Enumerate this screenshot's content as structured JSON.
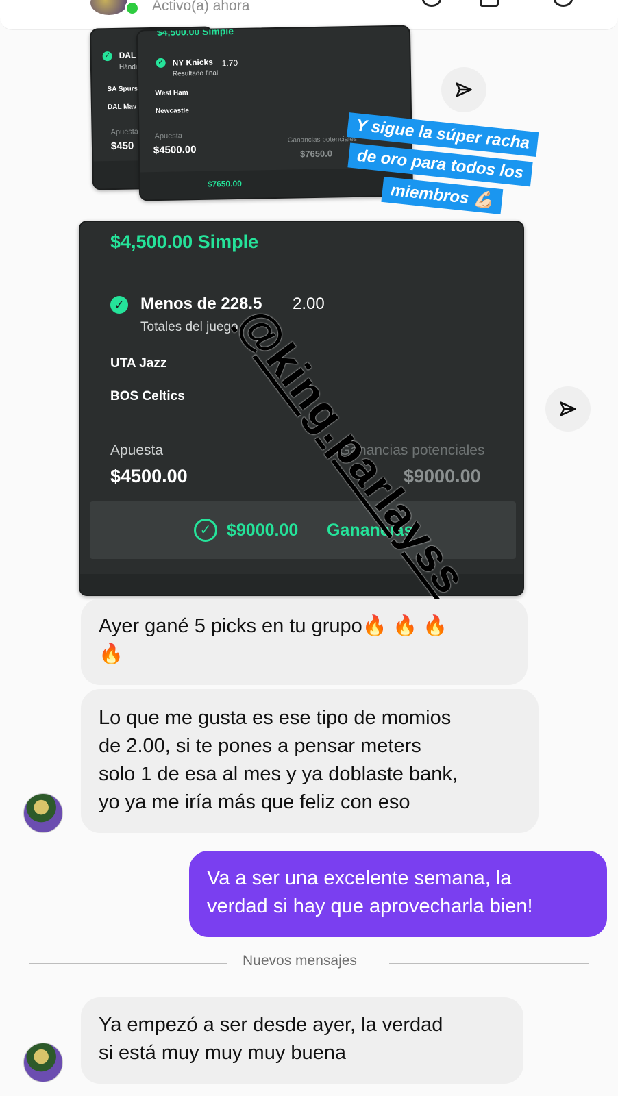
{
  "header": {
    "status_text": "Activo(a) ahora"
  },
  "story": {
    "back_slip": {
      "pick_label": "DAL I",
      "market": "Hándic",
      "team1": "SA Spurs",
      "team2": "DAL Mav",
      "stake_label": "Apuesta",
      "stake_value": "$450"
    },
    "mid_slip": {
      "title": "$4,500.00 Simple",
      "pick": "NY Knicks",
      "odds": "1.70",
      "market": "Resultado final",
      "team1": "West Ham",
      "team2": "Newcastle",
      "stake_label": "Apuesta",
      "stake_value": "$4500.00",
      "potential_label": "Ganancias potenciales",
      "potential_value": "$7650.0",
      "win_text": "$7650.00"
    },
    "main_slip": {
      "title": "$4,500.00 Simple",
      "pick": "Menos de 228.5",
      "odds": "2.00",
      "market": "Totales del juego",
      "team1": "UTA Jazz",
      "team2": "BOS Celtics",
      "stake_label": "Apuesta",
      "stake_value": "$4500.00",
      "potential_label": "Ganancias potenciales",
      "potential_value": "$9000.00",
      "win_amount": "$9000.00",
      "win_label": "Ganancias"
    },
    "sticker_lines": [
      "Y sigue la súper racha",
      "de oro para todos los",
      "miembros 💪🏻"
    ],
    "watermark": "@king.parlayss"
  },
  "messages": [
    {
      "side": "in",
      "lines": [
        "Ayer gané 5 picks en tu grupo🔥 🔥 🔥",
        "🔥"
      ]
    },
    {
      "side": "in",
      "lines": [
        "Lo que me gusta es ese tipo de momios",
        "de 2.00, si te pones a pensar meters",
        "solo 1 de esa al mes y ya doblaste bank,",
        "yo ya me iría más que feliz con eso"
      ]
    },
    {
      "side": "out",
      "lines": [
        "Va a ser una excelente semana, la",
        "verdad si hay que aprovecharla bien!"
      ]
    },
    {
      "side": "in",
      "lines": [
        "Ya empezó a ser desde ayer, la verdad",
        "si está muy muy muy buena"
      ]
    }
  ],
  "divider": {
    "label": "Nuevos mensajes"
  },
  "icons": {
    "share": "paper-plane-icon",
    "check": "check-circle-icon"
  },
  "colors": {
    "accent_green": "#25e39a",
    "outgoing_bubble": "#7a3ff0",
    "incoming_bubble": "#efefef",
    "sticker_blue": "#1a96f0"
  }
}
